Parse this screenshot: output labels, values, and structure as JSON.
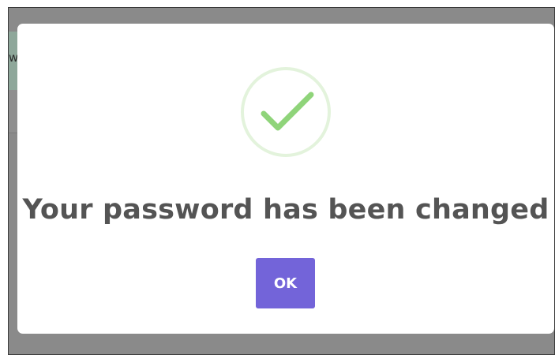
{
  "background": {
    "partial_text": "w"
  },
  "dialog": {
    "icon": "check-circle-icon",
    "message": "Your password has been changed",
    "ok_label": "OK"
  },
  "colors": {
    "accent": "#7364d9",
    "success": "#8fd47a",
    "success_ring": "#e3f3dc",
    "text": "#545454"
  }
}
